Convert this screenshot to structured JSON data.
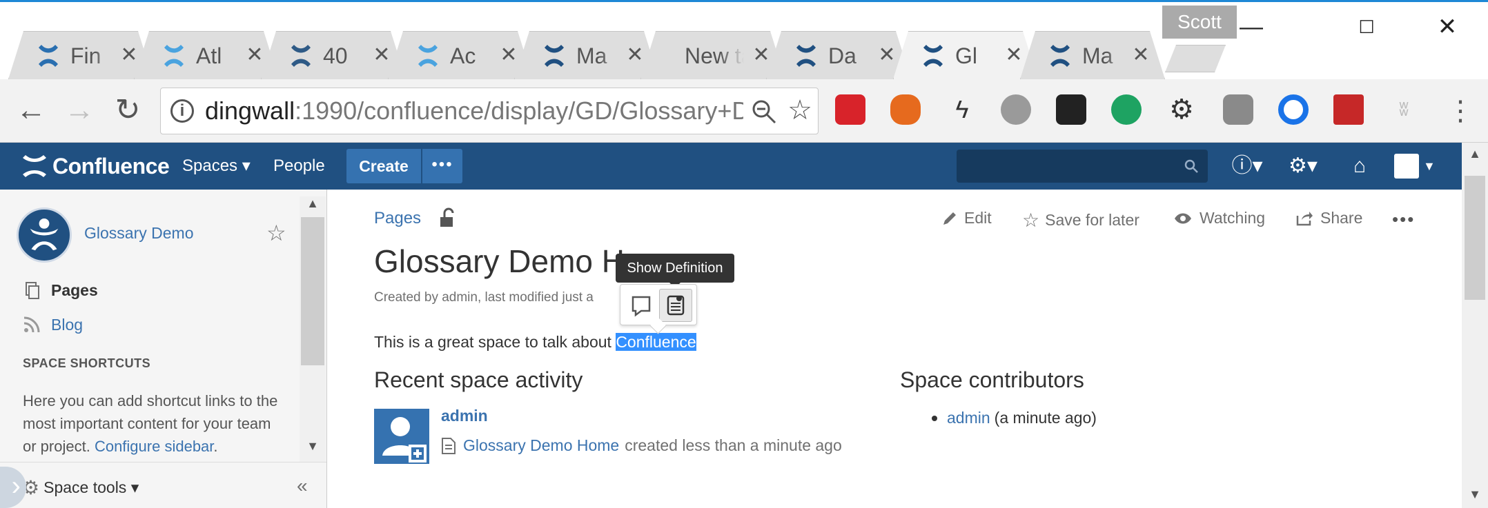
{
  "browser": {
    "profile_name": "Scott",
    "tabs": [
      {
        "title": "Fin",
        "icon": "confluence-people-icon"
      },
      {
        "title": "Atl",
        "icon": "atlassian-icon"
      },
      {
        "title": "40",
        "icon": "bucket-icon"
      },
      {
        "title": "Ac",
        "icon": "atlassian-icon"
      },
      {
        "title": "Ma",
        "icon": "confluence-icon"
      },
      {
        "title": "New ta",
        "icon": ""
      },
      {
        "title": "Da",
        "icon": "confluence-icon"
      },
      {
        "title": "Gl",
        "icon": "confluence-icon",
        "active": true
      },
      {
        "title": "Ma",
        "icon": "confluence-icon"
      }
    ],
    "url_host": "dingwall",
    "url_rest": ":1990/confluence/display/GD/Glossary+D"
  },
  "header": {
    "logo": "Confluence",
    "spaces": "Spaces",
    "people": "People",
    "create": "Create",
    "more": "•••",
    "colors": {
      "bar": "#205081",
      "button": "#3572b0"
    }
  },
  "sidebar": {
    "space_name": "Glossary Demo",
    "pages": "Pages",
    "blog": "Blog",
    "shortcuts_heading": "SPACE SHORTCUTS",
    "shortcuts_text": "Here you can add shortcut links to the most important content for your team or project.",
    "configure_link": "Configure sidebar",
    "space_tools": "Space tools"
  },
  "main": {
    "breadcrumb": "Pages",
    "actions": {
      "edit": "Edit",
      "save": "Save for later",
      "watching": "Watching",
      "share": "Share",
      "more": "•••"
    },
    "title": "Glossary Demo Home",
    "byline": "Created by admin, last modified just a minute ago",
    "body_prefix": "This is a great space to talk about ",
    "body_selected": "Confluence",
    "recent_heading": "Recent space activity",
    "activity_user": "admin",
    "activity_page": "Glossary Demo Home",
    "activity_suffix": "created less than a minute ago",
    "contributors_heading": "Space contributors",
    "contributor_name": "admin",
    "contributor_time": "(a minute ago)"
  },
  "tooltip": "Show Definition"
}
